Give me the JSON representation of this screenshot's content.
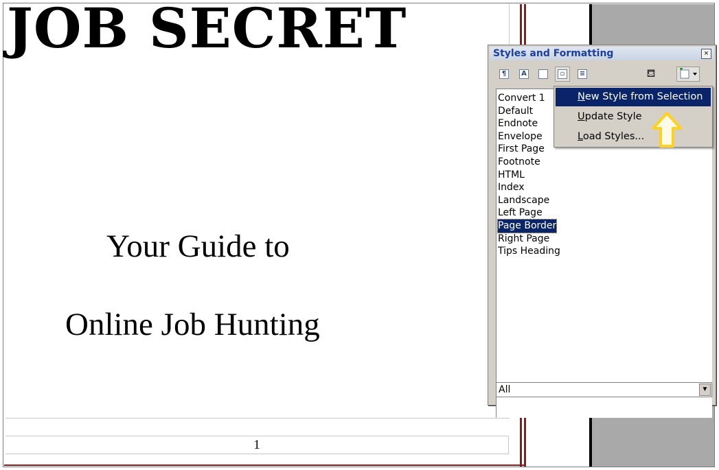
{
  "document": {
    "title": "JOB SECRET",
    "subtitle_line1": "Your Guide to",
    "subtitle_line2": "Online Job Hunting",
    "page_number": "1"
  },
  "panel": {
    "title": "Styles and Formatting",
    "close_glyph": "×",
    "toolbar": [
      {
        "name": "paragraph-styles",
        "icon": "paragraph-styles-icon"
      },
      {
        "name": "character-styles",
        "icon": "character-styles-icon"
      },
      {
        "name": "frame-styles",
        "icon": "frame-styles-icon"
      },
      {
        "name": "page-styles",
        "icon": "page-styles-icon"
      },
      {
        "name": "list-styles",
        "icon": "list-styles-icon"
      },
      {
        "name": "fill-format-mode",
        "icon": "paint-bucket-icon"
      },
      {
        "name": "new-style-from-selection",
        "icon": "new-style-icon"
      }
    ],
    "styles": [
      "Convert 1",
      "Default",
      "Endnote",
      "Envelope",
      "First Page",
      "Footnote",
      "HTML",
      "Index",
      "Landscape",
      "Left Page",
      "Page Border",
      "Right Page",
      "Tips Heading"
    ],
    "selected_style": "Page Border",
    "filter_value": "All"
  },
  "menu": {
    "items": [
      {
        "label_u": "N",
        "label_rest": "ew Style from Selection"
      },
      {
        "label_u": "U",
        "label_rest": "pdate Style"
      },
      {
        "label_u": "L",
        "label_rest": "oad Styles..."
      }
    ]
  },
  "colors": {
    "highlight": "#0a246a",
    "panel_bg": "#d4d0c8",
    "title_text": "#1c3fa0",
    "annotation_arrow": "#ffd21f",
    "page_border_red": "#8b1a1a"
  }
}
